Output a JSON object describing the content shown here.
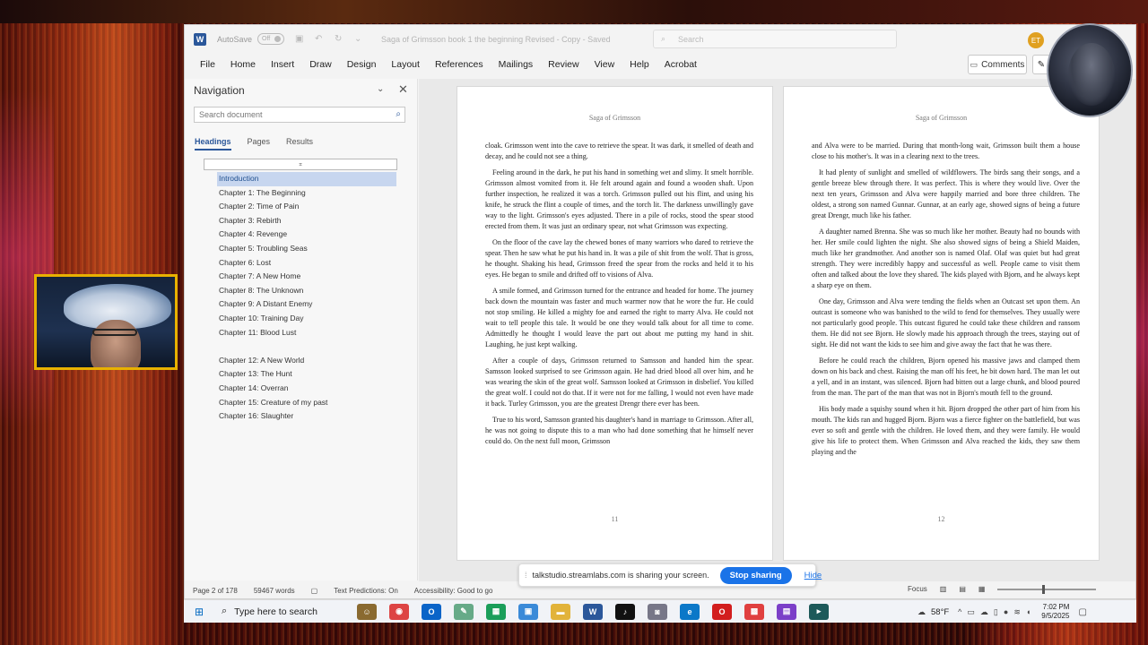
{
  "titlebar": {
    "autosave_label": "AutoSave",
    "autosave_state": "Off",
    "doc_title": "Saga of Grimsson book 1 the beginning Revised - Copy - Saved",
    "search_placeholder": "Search",
    "user_initials": "ET"
  },
  "menu": {
    "items": [
      "File",
      "Home",
      "Insert",
      "Draw",
      "Design",
      "Layout",
      "References",
      "Mailings",
      "Review",
      "View",
      "Help",
      "Acrobat"
    ],
    "comments_label": "Comments"
  },
  "navigation": {
    "title": "Navigation",
    "search_placeholder": "Search document",
    "tabs": [
      "Headings",
      "Pages",
      "Results"
    ],
    "active_tab": "Headings",
    "items": [
      "Introduction",
      "Chapter 1:  The Beginning",
      "Chapter 2:  Time of Pain",
      "Chapter 3:  Rebirth",
      "Chapter 4:  Revenge",
      "Chapter 5:  Troubling Seas",
      "Chapter 6:  Lost",
      "Chapter 7:  A New Home",
      "Chapter 8:  The Unknown",
      "Chapter 9:  A Distant Enemy",
      "Chapter 10:  Training Day",
      "Chapter 11:  Blood Lust",
      "Chapter 12:  A New World",
      "Chapter 13:  The Hunt",
      "Chapter 14: Overran",
      "Chapter 15:  Creature of my past",
      "Chapter 16:  Slaughter"
    ],
    "selected_item": "Introduction"
  },
  "pages": {
    "left": {
      "header": "Saga of Grimsson",
      "page_number": "11",
      "paragraphs": [
        "cloak. Grimsson went into the cave to retrieve the spear. It was dark, it smelled of death and decay, and he could not see a thing.",
        "Feeling around in the dark, he put his hand in something wet and slimy. It smelt horrible. Grimsson almost vomited from it. He felt around again and found a wooden shaft. Upon further inspection, he realized it was a torch. Grimsson pulled out his flint, and using his knife, he struck the flint a couple of times, and the torch lit. The darkness unwillingly gave way to the light. Grimsson's eyes adjusted. There in a pile of rocks, stood the spear stood erected from them. It was just an ordinary spear, not what Grimsson was expecting.",
        "On the floor of the cave lay the chewed bones of many warriors who dared to retrieve the spear. Then he saw what he put his hand in. It was a pile of shit from the wolf. That is gross, he thought. Shaking his head, Grimsson freed the spear from the rocks and held it to his eyes. He began to smile and drifted off to visions of Alva.",
        "A smile formed, and Grimsson turned for the entrance and headed for home. The journey back down the mountain was faster and much warmer now that he wore the fur. He could not stop smiling. He killed a mighty foe and earned the right to marry Alva. He could not wait to tell people this tale. It would be one they would talk about for all time to come. Admittedly he thought I would leave the part out about me putting my hand in shit. Laughing, he just kept walking.",
        "After a couple of days, Grimsson returned to Samsson and handed him the spear. Samsson looked surprised to see Grimsson again. He had dried blood all over him, and he was wearing the skin of the great wolf. Samsson looked at Grimsson in disbelief. You killed the great wolf. I could not do that. If it were not for me falling, I would not even have made it back. Turley Grimsson, you are the greatest Drengr there ever has been.",
        "True to his word, Samsson granted his daughter's hand in marriage to Grimsson. After all, he was not going to dispute this to a man who had done something that he himself never could do. On the next full moon, Grimsson"
      ]
    },
    "right": {
      "header": "Saga of Grimsson",
      "page_number": "12",
      "paragraphs": [
        "and Alva were to be married. During that month-long wait, Grimsson built them a house close to his mother's. It was in a clearing next to the trees.",
        "It had plenty of sunlight and smelled of wildflowers. The birds sang their songs, and a gentle breeze blew through there. It was perfect. This is where they would live. Over the next ten years, Grimsson and Alva were happily married and bore three children. The oldest, a strong son named Gunnar. Gunnar, at an early age, showed signs of being a future great Drengr, much like his father.",
        "A daughter named Brenna. She was so much like her mother. Beauty had no bounds with her. Her smile could lighten the night. She also showed signs of being a Shield Maiden, much like her grandmother. And another son is named Olaf. Olaf was quiet but had great strength. They were incredibly happy and successful as well. People came to visit them often and talked about the love they shared. The kids played with Bjorn, and he always kept a sharp eye on them.",
        "One day, Grimsson and Alva were tending the fields when an Outcast set upon them. An outcast is someone who was banished to the wild to fend for themselves. They usually were not particularly good people. This outcast figured he could take these children and ransom them. He did not see Bjorn. He slowly made his approach through the trees, staying out of sight. He did not want the kids to see him and give away the fact that he was there.",
        "Before he could reach the children, Bjorn opened his massive jaws and clamped them down on his back and chest. Raising the man off his feet, he bit down hard. The man let out a yell, and in an instant, was silenced. Bjorn had bitten out a large chunk, and blood poured from the man. The part of the man that was not in Bjorn's mouth fell to the ground.",
        "His body made a squishy sound when it hit. Bjorn dropped the other part of him from his mouth. The kids ran and hugged Bjorn. Bjorn was a fierce fighter on the battlefield, but was ever so soft and gentle with the children. He loved them, and they were family. He would give his life to protect them. When Grimsson and Alva reached the kids, they saw them playing and the"
      ]
    }
  },
  "statusbar": {
    "page": "Page 2 of 178",
    "words": "59467 words",
    "text_predictions": "Text Predictions: On",
    "accessibility": "Accessibility: Good to go",
    "focus": "Focus"
  },
  "share_bar": {
    "message": "talkstudio.streamlabs.com is sharing your screen.",
    "stop_label": "Stop sharing",
    "hide_label": "Hide"
  },
  "taskbar": {
    "search_label": "Type here to search",
    "weather": "58°F",
    "time": "7:02 PM",
    "date": "9/5/2025"
  },
  "colors": {
    "word_blue": "#2b579a",
    "share_blue": "#1a73e8",
    "nav_selected": "#c7d6ef",
    "webcam_border": "#e8b100"
  }
}
